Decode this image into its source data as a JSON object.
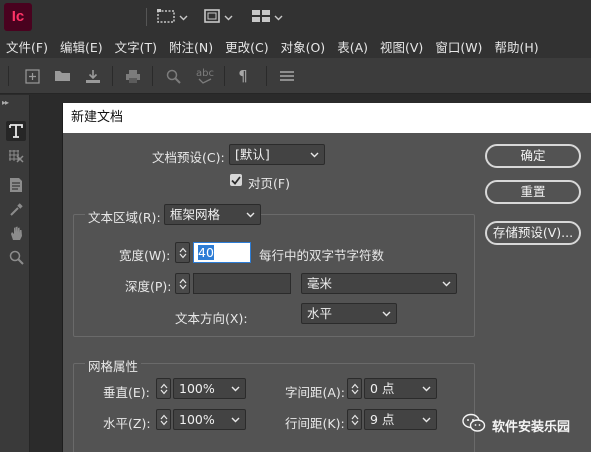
{
  "app": {
    "logo_text": "Ic",
    "brand_bg": "#49021f",
    "brand_fg": "#ff3366"
  },
  "menubar": {
    "items": [
      {
        "label": "文件(F)"
      },
      {
        "label": "编辑(E)"
      },
      {
        "label": "文字(T)"
      },
      {
        "label": "附注(N)"
      },
      {
        "label": "更改(C)"
      },
      {
        "label": "对象(O)"
      },
      {
        "label": "表(A)"
      },
      {
        "label": "视图(V)"
      },
      {
        "label": "窗口(W)"
      },
      {
        "label": "帮助(H)"
      }
    ]
  },
  "toolbar": {
    "icons": [
      "add-frame-icon",
      "open-folder-icon",
      "download-icon",
      "print-icon",
      "find-icon",
      "spellcheck-icon",
      "pilcrow-icon",
      "menu-icon"
    ],
    "spellcheck_text": "abc",
    "pilcrow_text": "¶"
  },
  "leftpanel": {
    "grip": "▸▸",
    "tools": [
      "type-tool-icon",
      "frame-grid-tool-icon",
      "note-tool-icon",
      "eyedropper-tool-icon",
      "hand-tool-icon",
      "zoom-tool-icon"
    ]
  },
  "dialog": {
    "title": "新建文档",
    "preset": {
      "label": "文档预设(C):",
      "value": "[默认]"
    },
    "facing_pages": {
      "label": "对页(F)",
      "checked": true
    },
    "text_area": {
      "label": "文本区域(R):",
      "value": "框架网格"
    },
    "width": {
      "label": "宽度(W):",
      "value": "40",
      "suffix": "每行中的双字节字符数"
    },
    "depth": {
      "label": "深度(P):",
      "value": "",
      "unit": "毫米"
    },
    "text_direction": {
      "label": "文本方向(X):",
      "value": "水平"
    },
    "grid_section": {
      "title": "网格属性"
    },
    "vertical": {
      "label": "垂直(E):",
      "value": "100%"
    },
    "horizontal": {
      "label": "水平(Z):",
      "value": "100%"
    },
    "char_spacing": {
      "label": "字间距(A):",
      "value": "0 点"
    },
    "line_spacing": {
      "label": "行间距(K):",
      "value": "9 点"
    },
    "buttons": {
      "ok": "确定",
      "reset": "重置",
      "save_preset": "存储预设(V)..."
    }
  },
  "watermark": {
    "text": "软件安装乐园"
  }
}
